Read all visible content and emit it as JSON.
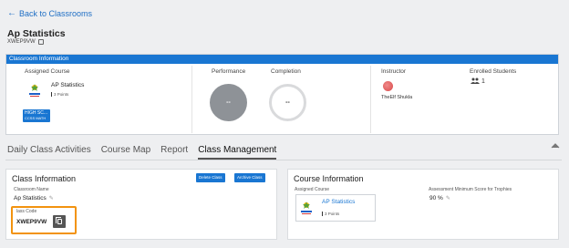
{
  "nav": {
    "back_label": "Back to Classrooms"
  },
  "classroom": {
    "title": "Ap Statistics",
    "code": "XWEP9VW"
  },
  "info_card": {
    "header": "Classroom Information",
    "assigned_course_label": "Assigned Course",
    "course_name": "AP Statistics",
    "course_points": "3 Points",
    "badge_line1": "HIGH SC...",
    "badge_line2": "CCSS MATH",
    "performance_label": "Performance",
    "performance_value": "--",
    "completion_label": "Completion",
    "completion_value": "--",
    "instructor_label": "Instructor",
    "instructor_name": "TheElf Shukla",
    "enrolled_label": "Enrolled Students",
    "enrolled_count": "1"
  },
  "tabs": [
    {
      "label": "Daily Class Activities"
    },
    {
      "label": "Course Map"
    },
    {
      "label": "Report"
    },
    {
      "label": "Class Management"
    }
  ],
  "class_info": {
    "title": "Class Information",
    "delete_label": "Delete Class",
    "archive_label": "Archive Class",
    "name_label": "Classroom Name",
    "name_value": "Ap Statistics",
    "code_label": "lass Code",
    "code_value": "XWEP9VW"
  },
  "course_info": {
    "title": "Course Information",
    "assigned_label": "Assigned Course",
    "course_name": "AP Statistics",
    "course_points": "3 Points",
    "min_score_label": "Assessment Minimum Score for Trophies",
    "min_score_value": "90 %"
  },
  "colors": {
    "accent": "#1976d2",
    "highlight": "#f2930f"
  }
}
